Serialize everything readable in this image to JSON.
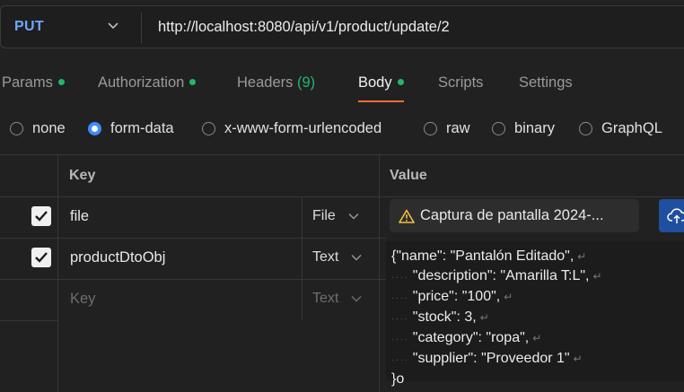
{
  "request": {
    "method": "PUT",
    "url": "http://localhost:8080/api/v1/product/update/2"
  },
  "tabs": [
    {
      "label": "Params",
      "dot": true
    },
    {
      "label": "Authorization",
      "dot": true
    },
    {
      "label": "Headers",
      "count": "(9)"
    },
    {
      "label": "Body",
      "dot": true,
      "active": true
    },
    {
      "label": "Scripts"
    },
    {
      "label": "Settings"
    }
  ],
  "body_types": [
    {
      "label": "none",
      "selected": false
    },
    {
      "label": "form-data",
      "selected": true
    },
    {
      "label": "x-www-form-urlencoded",
      "selected": false
    },
    {
      "label": "raw",
      "selected": false
    },
    {
      "label": "binary",
      "selected": false
    },
    {
      "label": "GraphQL",
      "selected": false
    }
  ],
  "table": {
    "headers": {
      "key": "Key",
      "value": "Value"
    },
    "rows": [
      {
        "checked": true,
        "key": "file",
        "type": "File",
        "value": "Captura de pantalla 2024-..."
      },
      {
        "checked": true,
        "key": "productDtoObj",
        "type": "Text",
        "value_lines": [
          "{\"name\": \"Pantalón Editado\",",
          "\"description\": \"Amarilla T:L\",",
          "\"price\": \"100\",",
          "\"stock\": 3,",
          "\"category\": \"ropa\",",
          "\"supplier\": \"Proveedor 1\"",
          "}o"
        ]
      },
      {
        "checked": false,
        "key_placeholder": "Key",
        "type_placeholder": "Text"
      }
    ]
  },
  "colors": {
    "accent": "#ff6c37",
    "method": "#6fa6ff",
    "status_dot": "#1fb86a",
    "radio_selected": "#3f8bff",
    "upload_button": "#1f4f9e"
  }
}
